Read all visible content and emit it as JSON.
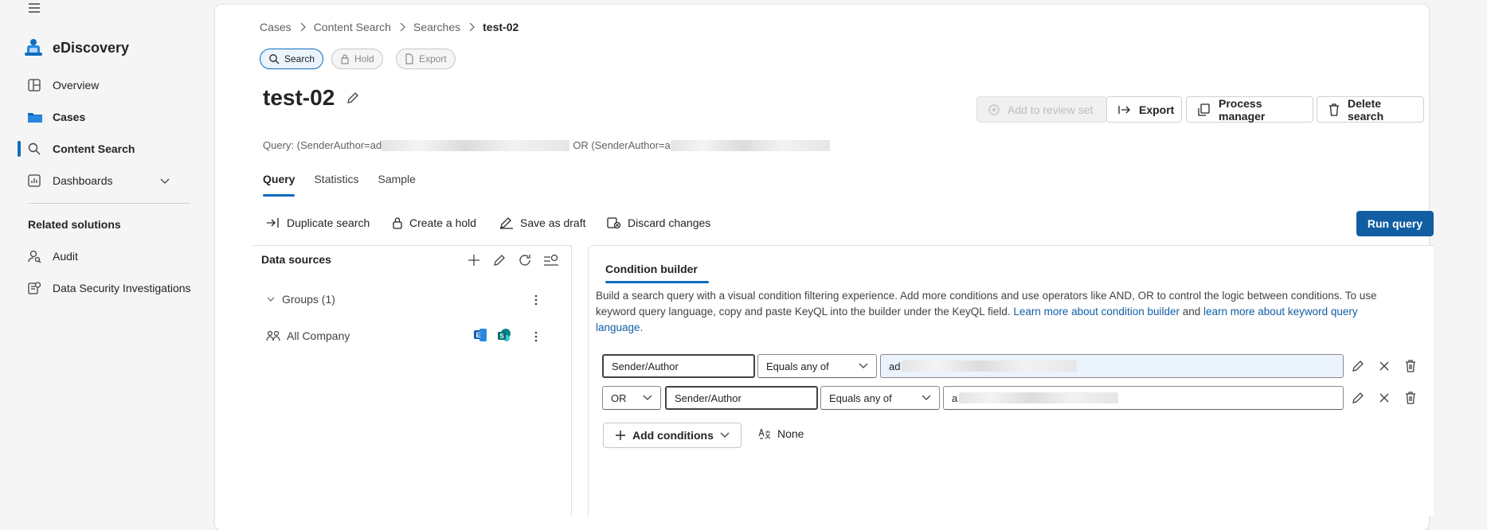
{
  "sidebar": {
    "app_name": "eDiscovery",
    "items": [
      {
        "label": "Overview"
      },
      {
        "label": "Cases"
      },
      {
        "label": "Content Search"
      },
      {
        "label": "Dashboards"
      }
    ],
    "related_title": "Related solutions",
    "related": [
      {
        "label": "Audit"
      },
      {
        "label": "Data Security Investigations"
      }
    ]
  },
  "breadcrumb": [
    "Cases",
    "Content Search",
    "Searches",
    "test-02"
  ],
  "pills": [
    {
      "label": "Search"
    },
    {
      "label": "Hold"
    },
    {
      "label": "Export"
    }
  ],
  "page_title": "test-02",
  "toolbar": {
    "add_review": "Add to review set",
    "export": "Export",
    "process": "Process manager",
    "delete": "Delete search"
  },
  "query": {
    "prefix": "Query: (SenderAuthor=ad",
    "middle": "OR (SenderAuthor=a"
  },
  "tabs": [
    "Query",
    "Statistics",
    "Sample"
  ],
  "actions": {
    "duplicate": "Duplicate search",
    "hold": "Create a hold",
    "draft": "Save as draft",
    "discard": "Discard changes",
    "run": "Run query"
  },
  "data_sources": {
    "title": "Data sources",
    "group": "Groups (1)",
    "item": "All Company"
  },
  "condition_builder": {
    "tab": "Condition builder",
    "desc1": "Build a search query with a visual condition filtering experience. Add more conditions and use operators like AND, OR to control the logic between conditions. To use keyword query language, copy and paste KeyQL into the builder under the KeyQL field. ",
    "link1": "Learn more about condition builder",
    "and": " and ",
    "link2": "learn more about keyword query language",
    "end": ".",
    "rows": [
      {
        "field": "Sender/Author",
        "op": "Equals any of",
        "value": "ad"
      },
      {
        "bool": "OR",
        "field": "Sender/Author",
        "op": "Equals any of",
        "value": "a"
      }
    ],
    "add_label": "Add conditions",
    "none_label": "None"
  },
  "colors": {
    "accent": "#0f6cbd",
    "run": "#115ea3"
  }
}
